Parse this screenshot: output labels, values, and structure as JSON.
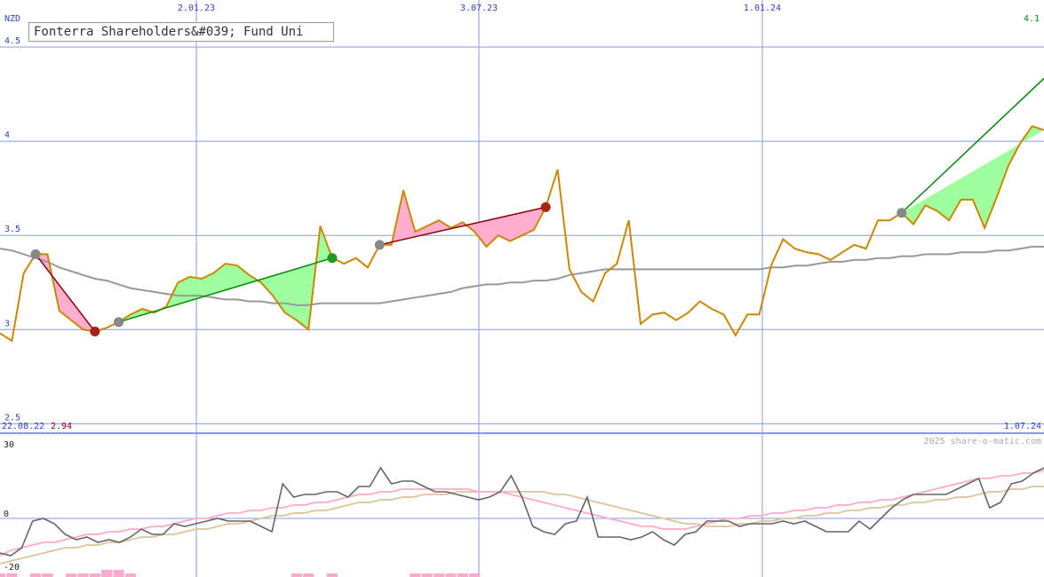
{
  "header": {
    "title": "Fonterra Shareholders&#039; Fund Uni",
    "currency": "NZD",
    "last_price": "4.1",
    "start_date": "22.08.22",
    "start_price": "2.94",
    "end_date": "1.07.24",
    "copyright": "2025 share-o-matic.com"
  },
  "colors": {
    "price": "#cc8800",
    "ma": "#999999",
    "grid": "#8899ee",
    "up_fill": "#99ff99",
    "down_fill": "#ffaacc",
    "up_line": "#008800",
    "down_line": "#880000",
    "osc_main": "#666666",
    "osc_fast": "#ffaacc",
    "osc_slow": "#ddc499"
  },
  "chart_data": [
    {
      "type": "line",
      "ylim": [
        2.45,
        4.75
      ],
      "y_ticks": [
        "4.5",
        "4",
        "3.5",
        "3",
        "2.5"
      ],
      "x_ticks": [
        "2.01.23",
        "3.07.23",
        "1.01.24"
      ],
      "series": [
        {
          "values": [
            2.98,
            2.94,
            3.3,
            3.4,
            3.4,
            3.1,
            3.05,
            3.0,
            2.99,
            3.01,
            3.04,
            3.08,
            3.11,
            3.09,
            3.12,
            3.25,
            3.28,
            3.27,
            3.3,
            3.35,
            3.34,
            3.29,
            3.25,
            3.18,
            3.09,
            3.05,
            3.0,
            3.55,
            3.38,
            3.35,
            3.38,
            3.33,
            3.45,
            3.45,
            3.74,
            3.52,
            3.55,
            3.58,
            3.54,
            3.57,
            3.52,
            3.44,
            3.5,
            3.47,
            3.5,
            3.53,
            3.65,
            3.85,
            3.32,
            3.2,
            3.15,
            3.3,
            3.35,
            3.58,
            3.03,
            3.08,
            3.09,
            3.05,
            3.09,
            3.15,
            3.11,
            3.08,
            2.97,
            3.08,
            3.08,
            3.34,
            3.48,
            3.43,
            3.41,
            3.4,
            3.37,
            3.41,
            3.45,
            3.43,
            3.58,
            3.58,
            3.62,
            3.56,
            3.66,
            3.63,
            3.58,
            3.69,
            3.69,
            3.54,
            3.7,
            3.87,
            3.99,
            4.08,
            4.06
          ]
        },
        {
          "values": [
            3.43,
            3.42,
            3.4,
            3.38,
            3.36,
            3.33,
            3.31,
            3.29,
            3.27,
            3.26,
            3.24,
            3.22,
            3.21,
            3.2,
            3.19,
            3.18,
            3.18,
            3.18,
            3.17,
            3.16,
            3.16,
            3.15,
            3.15,
            3.14,
            3.14,
            3.13,
            3.13,
            3.14,
            3.14,
            3.14,
            3.14,
            3.14,
            3.14,
            3.15,
            3.16,
            3.17,
            3.18,
            3.19,
            3.2,
            3.22,
            3.23,
            3.24,
            3.24,
            3.25,
            3.25,
            3.26,
            3.26,
            3.27,
            3.29,
            3.3,
            3.31,
            3.32,
            3.32,
            3.32,
            3.32,
            3.32,
            3.32,
            3.32,
            3.32,
            3.32,
            3.32,
            3.32,
            3.32,
            3.32,
            3.32,
            3.33,
            3.33,
            3.34,
            3.34,
            3.35,
            3.36,
            3.36,
            3.37,
            3.37,
            3.38,
            3.38,
            3.39,
            3.39,
            3.4,
            3.4,
            3.4,
            3.41,
            3.41,
            3.41,
            3.42,
            3.42,
            3.43,
            3.44,
            3.44
          ]
        }
      ],
      "signals": [
        {
          "type": "sell",
          "from_index": 3,
          "to_index": 8
        },
        {
          "type": "buy",
          "from_index": 10,
          "to_index": 28
        },
        {
          "type": "sell",
          "from_index": 32,
          "to_index": 46
        },
        {
          "type": "buy",
          "from_index": 76,
          "to_index": 95
        },
        {
          "type": "buy",
          "from_index": 96,
          "to_index": 100
        }
      ]
    },
    {
      "type": "line",
      "ylim": [
        -22,
        32
      ],
      "y_ticks": [
        "30",
        "0",
        "-20"
      ],
      "series": [
        {
          "values": [
            -13,
            -14,
            -11,
            -1,
            0,
            -2,
            -6,
            -8,
            -7,
            -9,
            -8,
            -9,
            -7,
            -4,
            -6,
            -6,
            -2,
            -3,
            -2,
            -1,
            0,
            -1,
            -1,
            -1,
            -3,
            -5,
            13,
            8,
            9,
            9,
            10,
            10,
            8,
            12,
            12,
            19,
            13,
            14,
            14,
            12,
            10,
            10,
            9,
            8,
            7,
            8,
            10,
            16,
            8,
            -3,
            -5,
            -6,
            -2,
            -1,
            8,
            -7,
            -7,
            -7,
            -8,
            -7,
            -5,
            -8,
            -10,
            -6,
            -5,
            -1,
            -1,
            -1,
            -3,
            -2,
            -2,
            -2,
            -1,
            -2,
            -1,
            -3,
            -5,
            -5,
            -5,
            -1,
            -4,
            0,
            4,
            7,
            9,
            9,
            9,
            9,
            11,
            13,
            15,
            4,
            6,
            13,
            14,
            17,
            19
          ]
        },
        {
          "values": [
            -14,
            -12,
            -11,
            -10,
            -9,
            -9,
            -8,
            -7,
            -6,
            -6,
            -5,
            -5,
            -4,
            -4,
            -3,
            -3,
            -2,
            -1,
            0,
            0,
            1,
            2,
            2,
            3,
            3,
            4,
            4,
            5,
            5,
            6,
            6,
            7,
            8,
            9,
            9,
            10,
            10,
            11,
            11,
            11,
            11,
            11,
            11,
            11,
            10,
            10,
            10,
            9,
            8,
            7,
            6,
            5,
            4,
            3,
            2,
            1,
            0,
            -1,
            -2,
            -3,
            -3,
            -4,
            -4,
            -4,
            -3,
            -2,
            -1,
            0,
            0,
            1,
            1,
            2,
            2,
            3,
            3,
            4,
            4,
            5,
            5,
            6,
            6,
            7,
            7,
            8,
            9,
            10,
            11,
            12,
            13,
            14,
            15,
            15,
            16,
            16,
            17,
            17,
            18
          ]
        },
        {
          "values": [
            -17,
            -16,
            -15,
            -14,
            -13,
            -12,
            -11,
            -11,
            -10,
            -10,
            -9,
            -9,
            -8,
            -7,
            -7,
            -6,
            -6,
            -5,
            -4,
            -4,
            -3,
            -2,
            -2,
            -1,
            0,
            1,
            1,
            2,
            2,
            3,
            3,
            4,
            5,
            6,
            6,
            7,
            7,
            8,
            8,
            9,
            9,
            9,
            10,
            10,
            10,
            10,
            10,
            10,
            10,
            10,
            10,
            9,
            9,
            8,
            7,
            6,
            5,
            4,
            3,
            2,
            1,
            0,
            -1,
            -2,
            -2,
            -3,
            -3,
            -3,
            -2,
            -2,
            -1,
            -1,
            0,
            0,
            1,
            1,
            2,
            2,
            3,
            3,
            4,
            4,
            5,
            5,
            6,
            6,
            7,
            7,
            8,
            8,
            9,
            10,
            10,
            11,
            11,
            12,
            12
          ]
        },
        {
          "values": [
            1,
            1,
            0,
            1,
            1,
            0,
            1,
            1,
            1,
            2,
            2,
            1,
            0,
            0,
            0,
            0,
            0,
            0,
            0,
            0,
            0,
            0,
            0,
            0,
            0,
            1,
            1,
            0,
            1,
            0,
            0,
            0,
            0,
            0,
            0,
            1,
            1,
            1,
            1,
            1,
            1,
            0,
            0,
            0,
            0,
            0,
            0,
            0,
            0,
            0,
            0,
            0,
            0,
            0,
            0,
            0,
            0,
            0,
            0,
            0,
            0,
            0,
            0,
            0,
            0,
            0,
            0,
            0,
            0,
            0,
            0,
            0,
            0,
            0,
            0,
            0,
            0,
            0,
            0,
            0,
            0,
            0,
            0,
            0,
            0,
            0,
            0,
            0,
            0,
            0,
            0,
            0,
            0,
            0,
            0,
            0,
            0
          ]
        }
      ]
    }
  ]
}
